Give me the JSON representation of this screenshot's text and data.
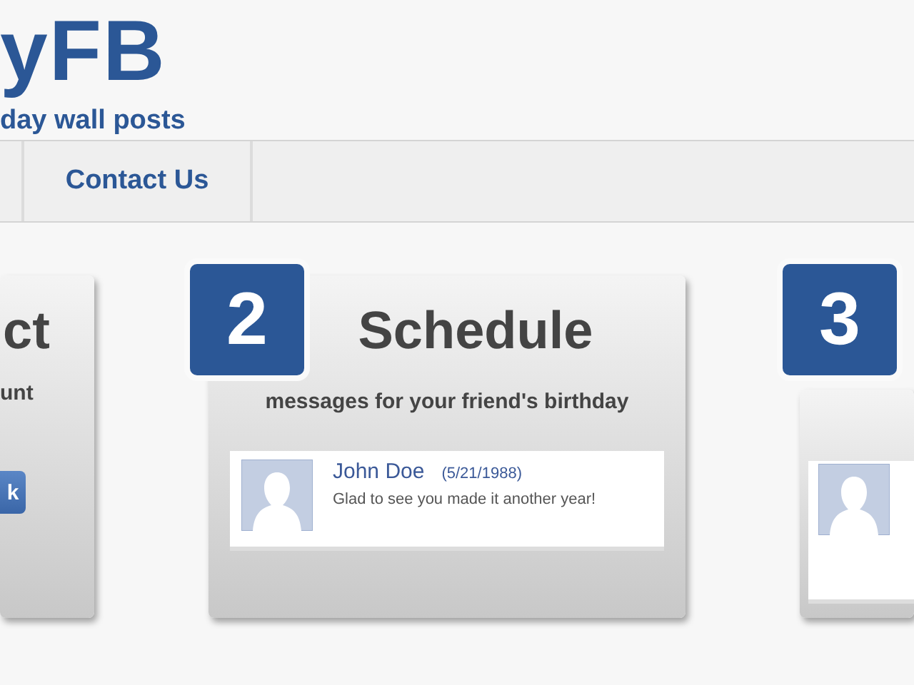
{
  "header": {
    "logo": "yFB",
    "tagline": "day wall posts"
  },
  "nav": [
    {
      "label": "Contact Us"
    }
  ],
  "step_1": {
    "title": "ct",
    "text": "unt",
    "button": "k"
  },
  "step_2": {
    "number": "2",
    "title": "Schedule",
    "text": "messages for your friend's birthday",
    "post": {
      "name": "John Doe",
      "date": "(5/21/1988)",
      "message": "Glad to see you made it another year!"
    }
  },
  "step_3": {
    "number": "3"
  }
}
